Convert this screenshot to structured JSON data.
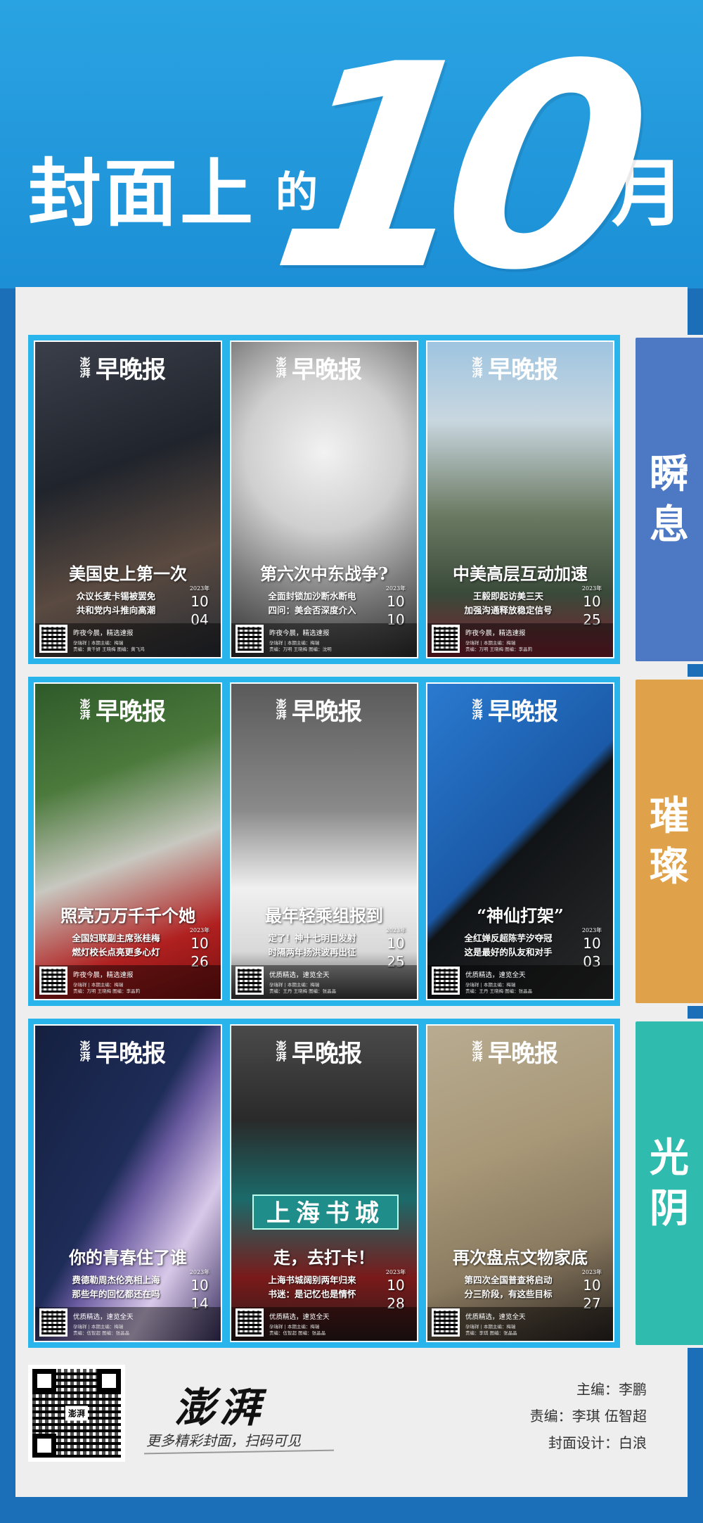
{
  "header": {
    "title_main": "封面上",
    "title_de": "的",
    "month_number": "10",
    "title_yue": "月"
  },
  "logo": {
    "small": "澎湃",
    "big": "早晚报"
  },
  "rows": [
    {
      "tab_label": "瞬息",
      "tab_color": "#4c78c4",
      "covers": [
        {
          "title": "美国史上第一次",
          "sub": "众议长麦卡锡被罢免\n共和党内斗推向高潮",
          "year": "2023年",
          "month": "10",
          "day": "04",
          "slogan": "昨夜今晨，精选速报",
          "credits": "孕瑞祥 | 本期主编：梅瑞\n责编：黄千妍 王晓梅 图编：黄飞鸿",
          "palette": "suits"
        },
        {
          "title": "第六次中东战争?",
          "sub": "全面封锁加沙断水断电\n四问：美会否深度介入",
          "year": "2023年",
          "month": "10",
          "day": "10",
          "slogan": "昨夜今晨，精选速报",
          "credits": "孕瑞祥 | 本期主编：梅瑞\n责编：万明 王晓梅 图编：沈明",
          "palette": "smoke"
        },
        {
          "title": "中美高层互动加速",
          "sub": "王毅即起访美三天\n加强沟通释放稳定信号",
          "year": "2023年",
          "month": "10",
          "day": "25",
          "slogan": "昨夜今晨，精选速报",
          "credits": "孕瑞祥 | 本期主编：梅瑞\n责编：万明 王晓梅 图编：李晶莉",
          "palette": "city"
        }
      ]
    },
    {
      "tab_label": "璀璨",
      "tab_color": "#dfa14a",
      "covers": [
        {
          "title": "照亮万万千千个她",
          "sub": "全国妇联副主席张桂梅\n燃灯校长点亮更多心灯",
          "year": "2023年",
          "month": "10",
          "day": "26",
          "slogan": "昨夜今晨，精选速报",
          "credits": "孕瑞祥 | 本期主编：梅瑞\n责编：万明 王晓梅 图编：李晶莉",
          "palette": "teacher"
        },
        {
          "title": "最年轻乘组报到",
          "sub": "定了！神十七明日发射\n时隔两年扬洪波再出征",
          "year": "2023年",
          "month": "10",
          "day": "25",
          "slogan": "优质精选，速览全天",
          "credits": "孕瑞祥 | 本期主编：梅瑞\n责编：王丹 王晓梅 图编：张晶晶",
          "palette": "astronaut"
        },
        {
          "title": "“神仙打架”",
          "sub": "全红婵反超陈芋汐夺冠\n这是最好的队友和对手",
          "year": "2023年",
          "month": "10",
          "day": "03",
          "slogan": "优质精选，速览全天",
          "credits": "孕瑞祥 | 本期主编：梅瑞\n责编：王丹 王晓梅 图编：张晶晶",
          "palette": "diving"
        }
      ]
    },
    {
      "tab_label": "光阴",
      "tab_color": "#2fbcae",
      "covers": [
        {
          "title": "你的青春住了谁",
          "sub": "费德勒周杰伦亮相上海\n那些年的回忆都还在吗",
          "year": "2023年",
          "month": "10",
          "day": "14",
          "slogan": "优质精选，速览全天",
          "credits": "孕瑞祥 | 本期主编：梅瑞\n责编：伍智超 图编：张晶晶",
          "palette": "stars"
        },
        {
          "title": "走，去打卡！",
          "sub": "上海书城阔别两年归来\n书迷：是记忆也是情怀",
          "year": "2023年",
          "month": "10",
          "day": "28",
          "slogan": "优质精选，速览全天",
          "credits": "孕瑞祥 | 本期主编：梅瑞\n责编：伍智超 图编：张晶晶",
          "palette": "bookcity"
        },
        {
          "title": "再次盘点文物家底",
          "sub": "第四次全国普查将启动\n分三阶段，有这些目标",
          "year": "2023年",
          "month": "10",
          "day": "27",
          "slogan": "优质精选，速览全天",
          "credits": "孕瑞祥 | 本期主编：梅瑞\n责编：李琪 图编：张晶晶",
          "palette": "mural"
        }
      ]
    }
  ],
  "bookcity_sign": "上海书城",
  "footer": {
    "qr_label": "澎湃",
    "brand": "澎湃",
    "slogan": "更多精彩封面，扫码可见",
    "chief_editor": "主编：李鹏",
    "editors": "责编：李琪  伍智超",
    "designer": "封面设计：白浪"
  },
  "colors": {
    "header_blue": "#1c8fd6",
    "frame_blue": "#2ab4ec",
    "panel_gray": "#eeeeee"
  }
}
